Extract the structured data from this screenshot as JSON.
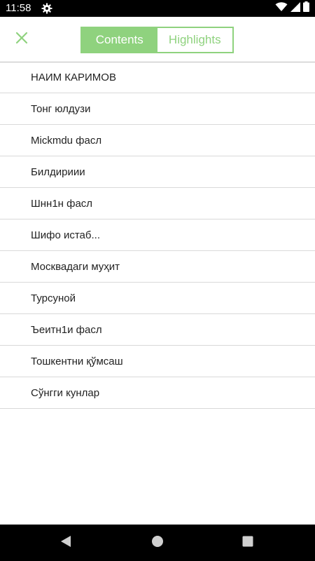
{
  "status_bar": {
    "time": "11:58",
    "left_icons": [
      "gear-icon"
    ],
    "right_icons": [
      "wifi-icon",
      "signal-icon",
      "battery-icon"
    ]
  },
  "header": {
    "close_icon": "close-icon",
    "tabs": [
      {
        "label": "Contents",
        "active": true
      },
      {
        "label": "Highlights",
        "active": false
      }
    ]
  },
  "toc": {
    "items": [
      "НАИМ КАРИМОВ",
      "Тонг юлдузи",
      "Mickmdu фасл",
      "Билдириии",
      "Шнн1н фасл",
      "Шифо истаб...",
      "Москвадаги муҳит",
      "Турсуной",
      "Ъеитн1и фасл",
      "Тошкентни қўмсаш",
      "Сўнгги кунлар"
    ]
  },
  "nav_bar": {
    "icons": [
      "back-icon",
      "home-icon",
      "recents-icon"
    ]
  },
  "colors": {
    "accent": "#8fd27e",
    "status_bar": "#000000",
    "nav_bar": "#000000",
    "divider": "#d9d9d9",
    "text": "#222222"
  }
}
